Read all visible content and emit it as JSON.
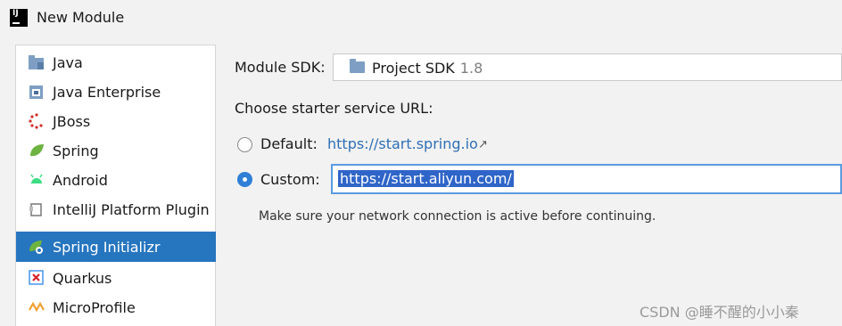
{
  "window": {
    "title": "New Module",
    "app_icon": "intellij-logo"
  },
  "sidebar": {
    "items": [
      {
        "label": "Java",
        "icon": "folder-icon"
      },
      {
        "label": "Java Enterprise",
        "icon": "java-enterprise-icon"
      },
      {
        "label": "JBoss",
        "icon": "jboss-icon"
      },
      {
        "label": "Spring",
        "icon": "spring-leaf-icon"
      },
      {
        "label": "Android",
        "icon": "android-icon"
      },
      {
        "label": "IntelliJ Platform Plugin",
        "icon": "plugin-icon"
      },
      {
        "label": "Spring Initializr",
        "icon": "spring-initializr-icon",
        "selected": true
      },
      {
        "label": "Quarkus",
        "icon": "quarkus-icon"
      },
      {
        "label": "MicroProfile",
        "icon": "microprofile-icon"
      }
    ]
  },
  "form": {
    "sdk_label": "Module SDK:",
    "sdk_value": "Project SDK",
    "sdk_version": "1.8",
    "starter_label": "Choose starter service URL:",
    "default_label": "Default:",
    "default_url": "https://start.spring.io",
    "custom_label": "Custom:",
    "custom_url": "https://start.aliyun.com/",
    "selected_option": "custom",
    "hint": "Make sure your network connection is active before continuing."
  },
  "watermark": "CSDN @睡不醒的小小秦",
  "colors": {
    "selection": "#2675bf",
    "link": "#2f6fb5",
    "radio_on": "#2f7fd6"
  }
}
